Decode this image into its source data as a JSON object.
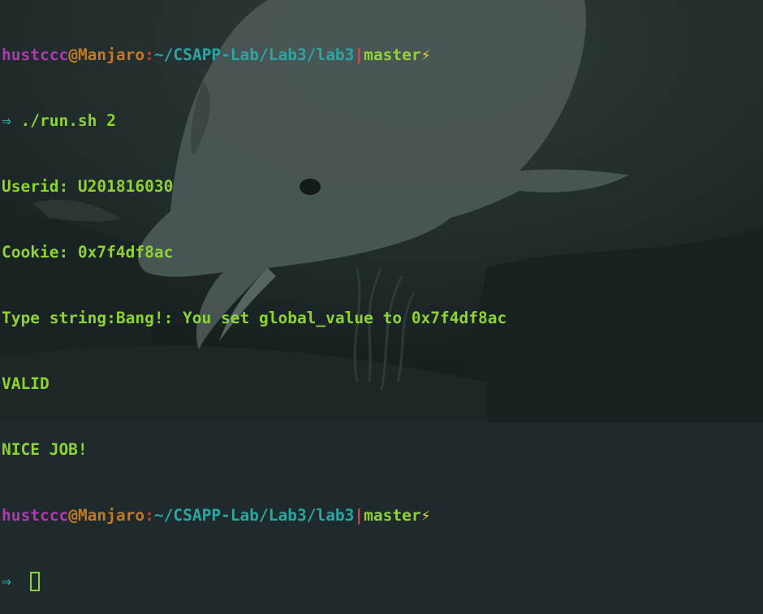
{
  "wallpaper": {
    "icon": "dolphin-underwater-wallpaper",
    "colors": {
      "water": "#1e2a2b",
      "dolphin": "#4c5a5a"
    }
  },
  "prompt": {
    "user": "hustccc",
    "at": "@",
    "host": "Manjaro",
    "colon": ":",
    "path": "~/CSAPP-Lab/Lab3/lab3",
    "separator": "|",
    "branch": "master",
    "bolt": "⚡",
    "arrow": "⇒"
  },
  "session": {
    "command": " ./run.sh 2",
    "output": [
      "Userid: U201816030",
      "Cookie: 0x7f4df8ac",
      "Type string:Bang!: You set global_value to 0x7f4df8ac",
      "VALID",
      "NICE JOB!"
    ]
  },
  "colors": {
    "user": "#b537b0",
    "host": "#c07a26",
    "path": "#2aa7a2",
    "text": "#8fd234",
    "bolt": "#f1d13a",
    "separator": "#d8474f"
  }
}
